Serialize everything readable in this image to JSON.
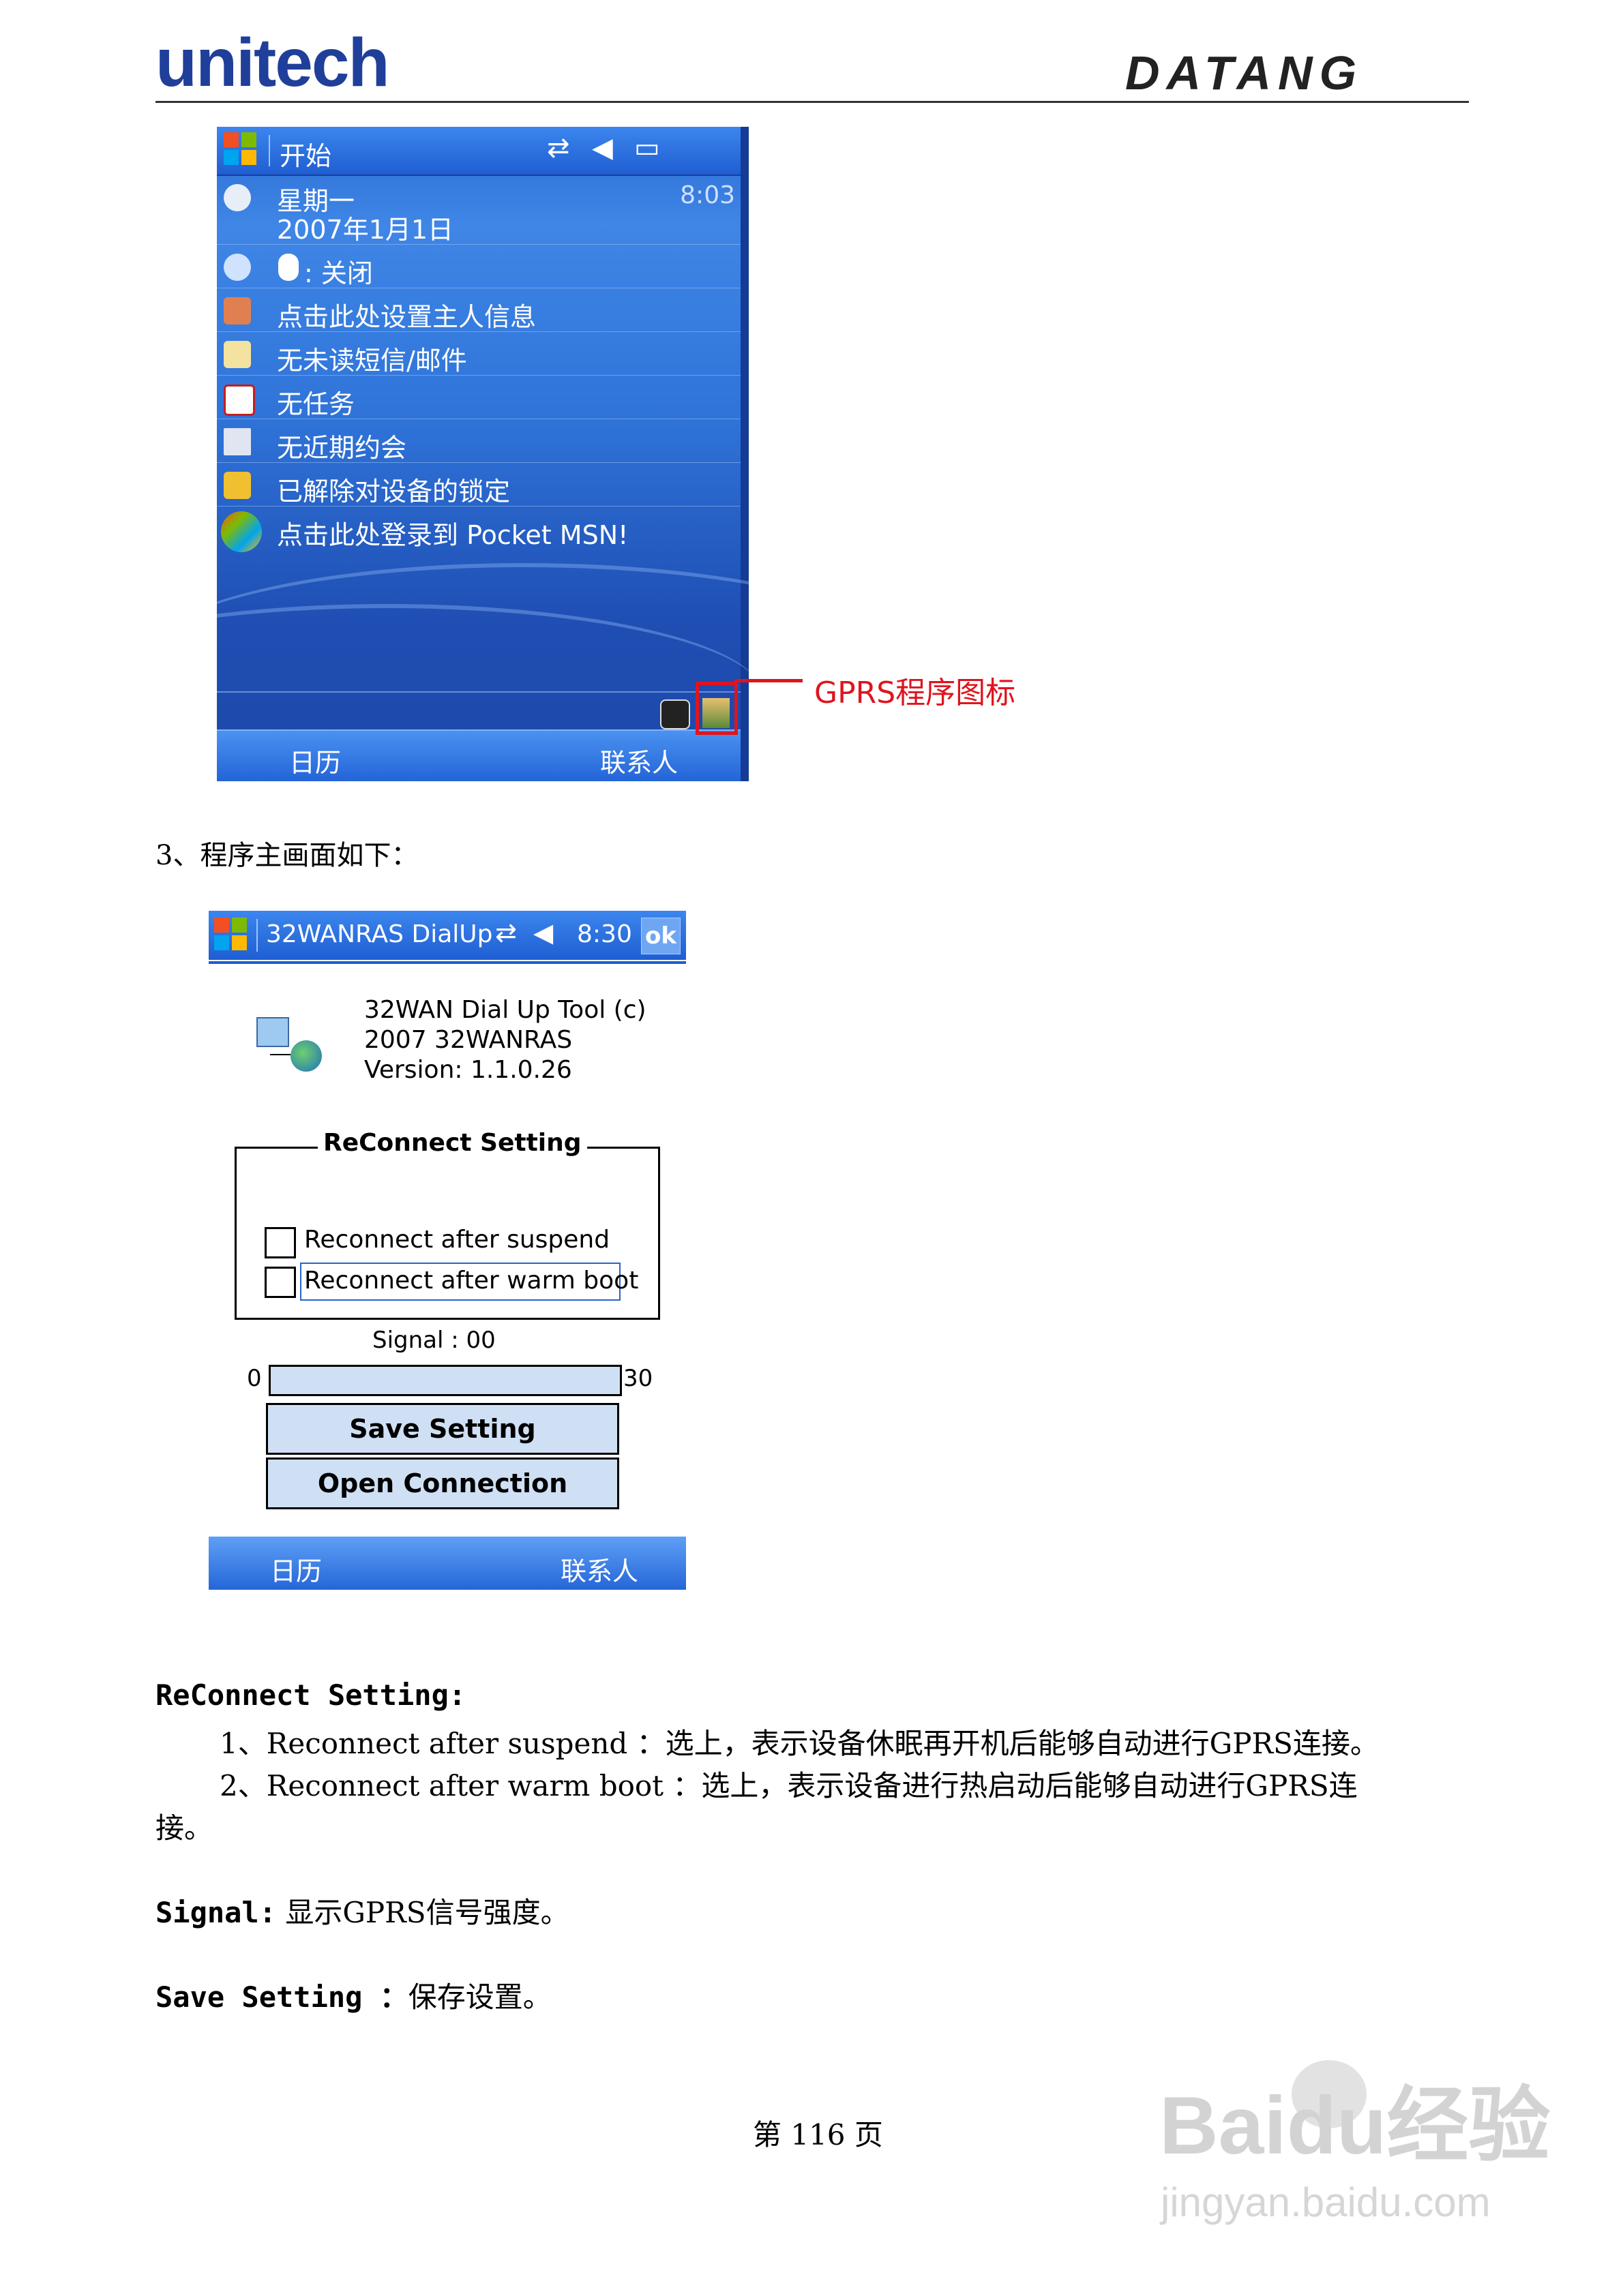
{
  "header": {
    "left_logo": "unitech",
    "right_logo": "DATANG"
  },
  "screen1": {
    "title": "开始",
    "time": "8:03",
    "day": "星期一",
    "date": "2007年1月1日",
    "rows": [
      {
        "icon": "bluetooth-icon",
        "text": ": 关闭"
      },
      {
        "icon": "owner-icon",
        "text": "点击此处设置主人信息"
      },
      {
        "icon": "mail-icon",
        "text": "无未读短信/邮件"
      },
      {
        "icon": "tasks-icon",
        "text": "无任务"
      },
      {
        "icon": "calendar-icon",
        "text": "无近期约会"
      },
      {
        "icon": "lock-icon",
        "text": "已解除对设备的锁定"
      },
      {
        "icon": "msn-icon",
        "text": "点击此处登录到 Pocket MSN!"
      }
    ],
    "softkey_left": "日历",
    "softkey_right": "联系人",
    "callout": "GPRS程序图标"
  },
  "step3": "3、程序主画面如下：",
  "screen2": {
    "title": "32WANRAS DialUp",
    "time": "8:30",
    "ok": "ok",
    "about_line1": "32WAN Dial Up Tool (c)",
    "about_line2": "2007 32WANRAS",
    "about_line3": "Version: 1.1.0.26",
    "group_title": "ReConnect Setting",
    "checkbox1": "Reconnect after suspend",
    "checkbox2": "Reconnect after warm boot",
    "signal_label": "Signal : 00",
    "range_min": "0",
    "range_max": "30",
    "signal_value": 0,
    "save_button": "Save Setting",
    "open_button": "Open Connection",
    "softkey_left": "日历",
    "softkey_right": "联系人"
  },
  "body": {
    "reconnect_heading": "ReConnect Setting:",
    "item1": "1、Reconnect after suspend ：选上，表示设备休眠再开机后能够自动进行GPRS连接。",
    "item2_line1": "2、Reconnect after warm boot ：选上，表示设备进行热启动后能够自动进行GPRS连",
    "item2_line2": "接。",
    "signal_term": "Signal:",
    "signal_desc": "显示GPRS信号强度。",
    "save_term": "Save Setting ：",
    "save_desc": "保存设置。"
  },
  "footer": {
    "page": "第 116 页"
  },
  "watermark": {
    "brand": "Baidu经验",
    "url": "jingyan.baidu.com"
  }
}
